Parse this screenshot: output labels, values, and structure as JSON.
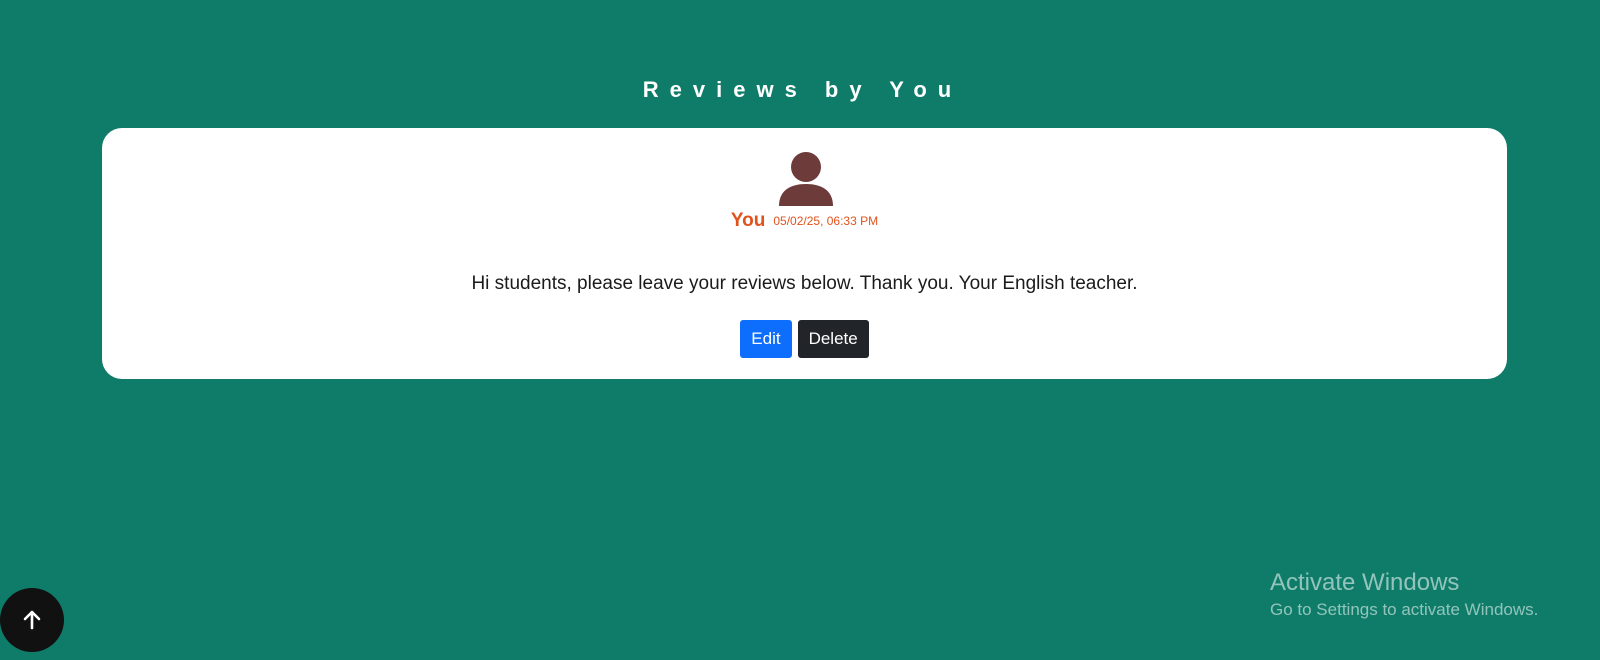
{
  "section": {
    "title": "Reviews by You"
  },
  "review": {
    "author": "You",
    "timestamp": "05/02/25, 06:33 PM",
    "text": "Hi students, please leave your reviews below. Thank you. Your English teacher.",
    "avatar_icon": "user-avatar-icon",
    "avatar_color": "#6d3b3a",
    "author_color": "#e0531c"
  },
  "actions": {
    "edit_label": "Edit",
    "delete_label": "Delete",
    "edit_color": "#0d6efd",
    "delete_color": "#212529"
  },
  "scroll_top": {
    "icon": "arrow-up-icon"
  },
  "watermark": {
    "title": "Activate Windows",
    "subtitle": "Go to Settings to activate Windows."
  },
  "colors": {
    "background": "#0e7c69",
    "card": "#ffffff"
  }
}
